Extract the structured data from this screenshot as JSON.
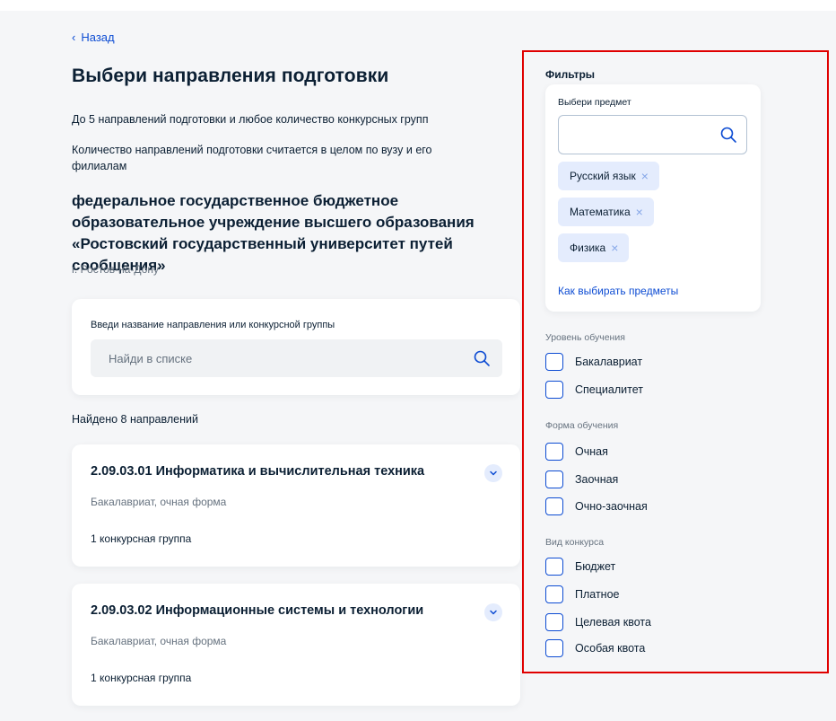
{
  "nav": {
    "back_label": "Назад"
  },
  "page": {
    "title": "Выбери направления подготовки",
    "note1": "До 5 направлений подготовки и любое количество конкурсных групп",
    "note2": "Количество направлений подготовки считается в целом по вузу и его филиалам",
    "university": "федеральное государственное бюджетное образовательное учреждение высшего образования «Ростовский государственный университет путей сообщения»",
    "city": "г. Ростов-на-Дону"
  },
  "search": {
    "label": "Введи название направления или конкурсной группы",
    "placeholder": "Найди в списке",
    "icon": "search-icon"
  },
  "results": {
    "found_text": "Найдено 8 направлений",
    "items": [
      {
        "title": "2.09.03.01 Информатика и вычислительная техника",
        "subtitle": "Бакалавриат, очная форма",
        "groups": "1 конкурсная группа"
      },
      {
        "title": "2.09.03.02 Информационные системы и технологии",
        "subtitle": "Бакалавриат, очная форма",
        "groups": "1 конкурсная группа"
      }
    ]
  },
  "filters": {
    "title": "Фильтры",
    "subject": {
      "label": "Выбери предмет",
      "value": "",
      "chips": [
        "Русский язык",
        "Математика",
        "Физика"
      ],
      "howto_link": "Как выбирать предметы"
    },
    "level": {
      "label": "Уровень обучения",
      "options": [
        "Бакалавриат",
        "Специалитет"
      ]
    },
    "form": {
      "label": "Форма обучения",
      "options": [
        "Очная",
        "Заочная",
        "Очно-заочная"
      ]
    },
    "contest": {
      "label": "Вид конкурса",
      "options": [
        "Бюджет",
        "Платное",
        "Целевая квота",
        "Особая квота"
      ]
    }
  },
  "colors": {
    "link": "#0d4cd3",
    "highlight_border": "#e00000",
    "chip_bg": "#e4ecfd",
    "text": "#0b1f33",
    "muted": "#66727f"
  }
}
